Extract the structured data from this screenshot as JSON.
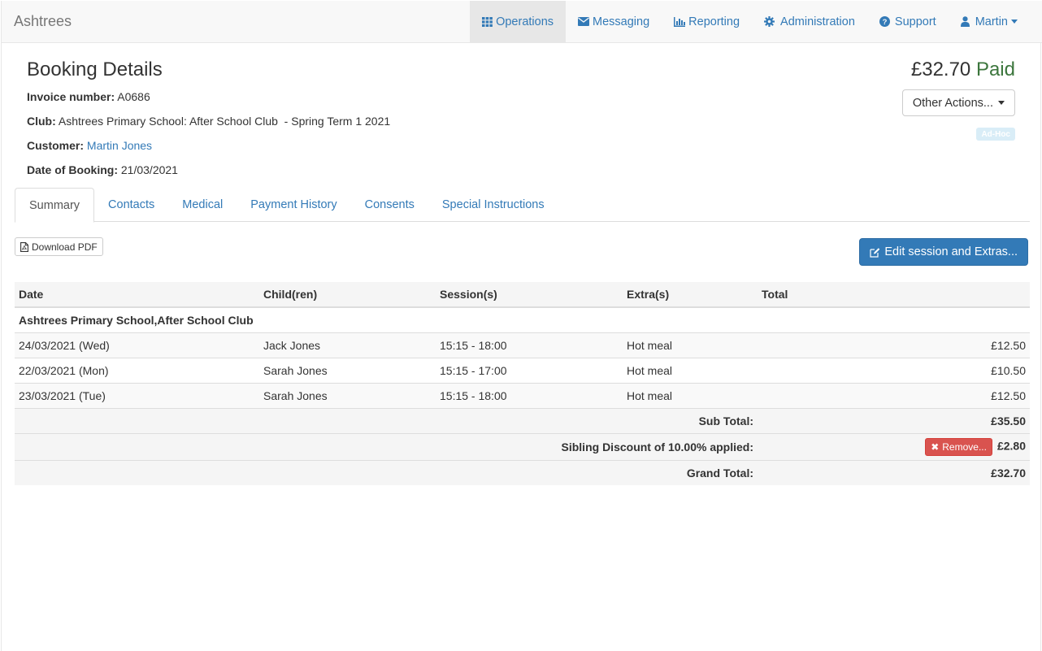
{
  "nav": {
    "brand": "Ashtrees",
    "items": [
      {
        "label": "Operations",
        "icon": "grid-icon"
      },
      {
        "label": "Messaging",
        "icon": "envelope-icon"
      },
      {
        "label": "Reporting",
        "icon": "bar-chart-icon"
      },
      {
        "label": "Administration",
        "icon": "gear-icon"
      },
      {
        "label": "Support",
        "icon": "question-circle-icon"
      },
      {
        "label": "Martin",
        "icon": "user-icon"
      }
    ]
  },
  "booking": {
    "title": "Booking Details",
    "invoice_label": "Invoice number:",
    "invoice_value": "A0686",
    "club_label": "Club:",
    "club_value": "Ashtrees Primary School: After School Club  - Spring Term 1 2021",
    "customer_label": "Customer:",
    "customer_value": "Martin Jones",
    "date_label": "Date of Booking:",
    "date_value": "21/03/2021",
    "amount": "£32.70",
    "status": "Paid",
    "other_actions_label": "Other Actions...",
    "badge": "Ad-Hoc"
  },
  "tabs": [
    "Summary",
    "Contacts",
    "Medical",
    "Payment History",
    "Consents",
    "Special Instructions"
  ],
  "actions": {
    "download_pdf": "Download PDF",
    "edit_session": "Edit session and Extras..."
  },
  "table": {
    "headers": [
      "Date",
      "Child(ren)",
      "Session(s)",
      "Extra(s)",
      "Total"
    ],
    "group": "Ashtrees Primary School,After School Club",
    "rows": [
      {
        "date": "24/03/2021 (Wed)",
        "child": "Jack Jones",
        "session": "15:15 - 18:00",
        "extra": "Hot meal",
        "total": "£12.50"
      },
      {
        "date": "22/03/2021 (Mon)",
        "child": "Sarah Jones",
        "session": "15:15 - 17:00",
        "extra": "Hot meal",
        "total": "£10.50"
      },
      {
        "date": "23/03/2021 (Tue)",
        "child": "Sarah Jones",
        "session": "15:15 - 18:00",
        "extra": "Hot meal",
        "total": "£12.50"
      }
    ],
    "subtotal_label": "Sub Total:",
    "subtotal_value": "£35.50",
    "discount_label": "Sibling Discount of 10.00%  applied:",
    "remove_label": "Remove...",
    "discount_value": "£2.80",
    "grand_total_label": "Grand Total:",
    "grand_total_value": "£32.70"
  },
  "colors": {
    "link": "#337ab7",
    "paid": "#3c763d",
    "danger": "#d9534f",
    "primary": "#337ab7"
  }
}
